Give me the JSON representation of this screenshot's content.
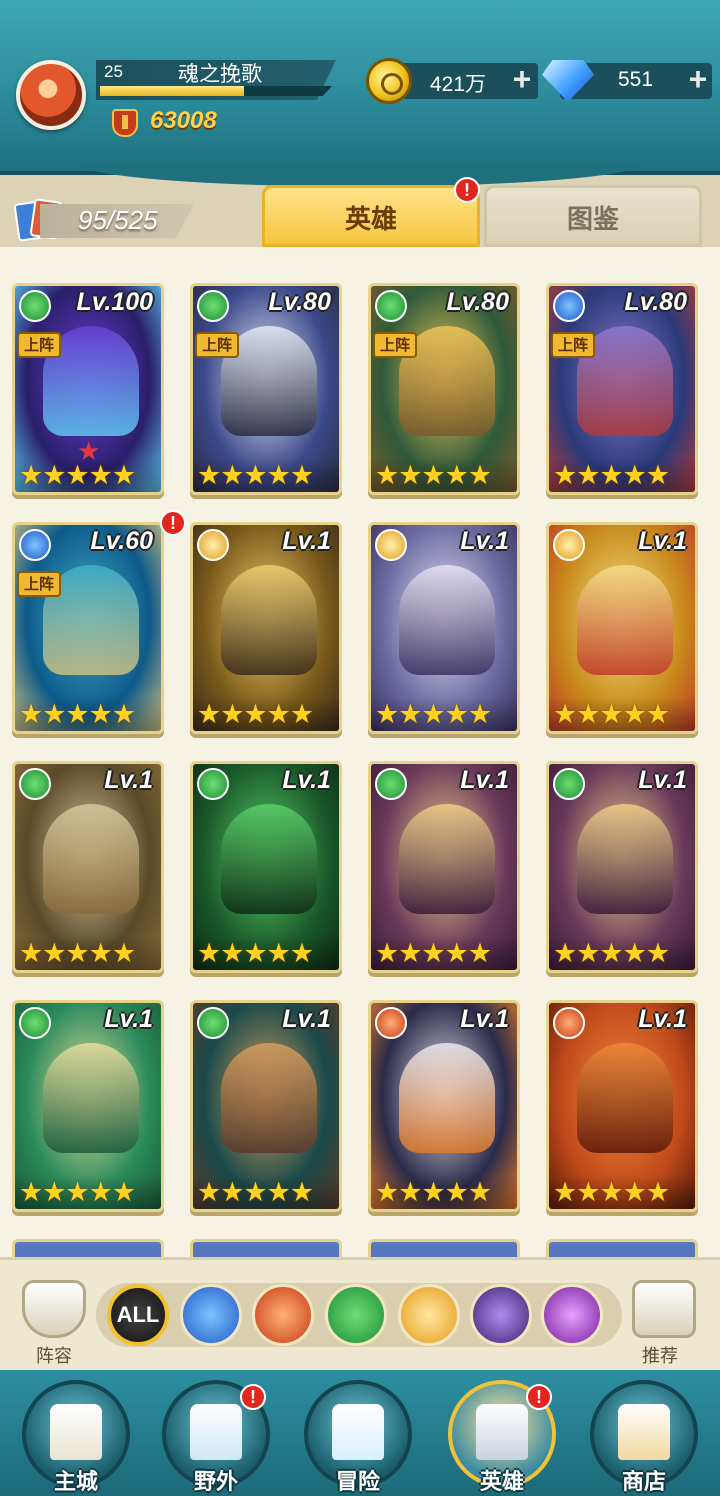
{
  "player": {
    "level": "25",
    "name": "魂之挽歌",
    "xp_fraction": 0.62,
    "power": "63008"
  },
  "resources": {
    "gold": "421万",
    "gems": "551",
    "plus": "+"
  },
  "hero_count": "95/525",
  "tabs": {
    "heroes": "英雄",
    "codex": "图鉴",
    "badge": "!"
  },
  "heroes": [
    {
      "level": "Lv.100",
      "element": "green",
      "deployed": true,
      "stars": "★★★★★",
      "red_star": true,
      "colors": [
        "#2a1f6b",
        "#6a3fd4",
        "#5ec8f0"
      ]
    },
    {
      "level": "Lv.80",
      "element": "green",
      "deployed": true,
      "stars": "★★★★★",
      "colors": [
        "#3b4a8c",
        "#e8ecf5",
        "#2a2a3e"
      ]
    },
    {
      "level": "Lv.80",
      "element": "green",
      "deployed": true,
      "stars": "★★★★★",
      "colors": [
        "#2f5a3a",
        "#f2c75a",
        "#7a5a2a"
      ]
    },
    {
      "level": "Lv.80",
      "element": "blue",
      "deployed": true,
      "stars": "★★★★★",
      "colors": [
        "#2a3a7a",
        "#8c7ad0",
        "#b03a3a"
      ]
    },
    {
      "level": "Lv.60",
      "element": "blue",
      "deployed": true,
      "stars": "★★★★★",
      "badge": true,
      "colors": [
        "#0e5a8a",
        "#3fb0c8",
        "#d0c080"
      ]
    },
    {
      "level": "Lv.1",
      "element": "light",
      "deployed": false,
      "stars": "★★★★★",
      "colors": [
        "#7a5a1a",
        "#f0d070",
        "#3a2a1a"
      ]
    },
    {
      "level": "Lv.1",
      "element": "light",
      "deployed": false,
      "stars": "★★★★★",
      "colors": [
        "#6a6aa0",
        "#e8e4f4",
        "#3a3060"
      ]
    },
    {
      "level": "Lv.1",
      "element": "light",
      "deployed": false,
      "stars": "★★★★★",
      "colors": [
        "#c88a1a",
        "#f5e08a",
        "#c03a2a"
      ]
    },
    {
      "level": "Lv.1",
      "element": "green",
      "deployed": false,
      "stars": "★★★★★",
      "colors": [
        "#5a4a2a",
        "#d8c8a0",
        "#8a6a3a"
      ]
    },
    {
      "level": "Lv.1",
      "element": "green",
      "deployed": false,
      "stars": "★★★★★",
      "colors": [
        "#1a5a2a",
        "#5ad06a",
        "#0e2a14"
      ]
    },
    {
      "level": "Lv.1",
      "element": "green",
      "deployed": false,
      "stars": "★★★★★",
      "colors": [
        "#6a3a5a",
        "#f0d08a",
        "#3a1a3a"
      ]
    },
    {
      "level": "Lv.1",
      "element": "green",
      "deployed": false,
      "stars": "★★★★★",
      "colors": [
        "#6a3a5a",
        "#f0d08a",
        "#3a1a3a"
      ]
    },
    {
      "level": "Lv.1",
      "element": "green",
      "deployed": false,
      "stars": "★★★★★",
      "colors": [
        "#2a8a5a",
        "#e8e0a0",
        "#1a5a3a"
      ]
    },
    {
      "level": "Lv.1",
      "element": "green",
      "deployed": false,
      "stars": "★★★★★",
      "colors": [
        "#1a4a4a",
        "#d8a060",
        "#5a3a2a"
      ]
    },
    {
      "level": "Lv.1",
      "element": "fire",
      "deployed": false,
      "stars": "★★★★★",
      "colors": [
        "#2a2a4a",
        "#e8e8f0",
        "#e07a2a"
      ]
    },
    {
      "level": "Lv.1",
      "element": "fire",
      "deployed": false,
      "stars": "★★★★★",
      "colors": [
        "#c04a1a",
        "#f08a3a",
        "#5a1a0a"
      ]
    }
  ],
  "deploy_label": "上阵",
  "card_badge": "!",
  "filters": {
    "all": "ALL",
    "lineup": "阵容",
    "recommend": "推荐"
  },
  "nav": [
    {
      "label": "主城",
      "icon": "castle-icon",
      "color": "#e9e3d2"
    },
    {
      "label": "野外",
      "icon": "portal-icon",
      "color": "#cfe8f5",
      "badge": true
    },
    {
      "label": "冒险",
      "icon": "sword-icon",
      "color": "#d8f0ff"
    },
    {
      "label": "英雄",
      "icon": "helmet-icon",
      "color": "#c9d3de",
      "badge": true,
      "active": true
    },
    {
      "label": "商店",
      "icon": "shop-icon",
      "color": "#f2d8a0"
    }
  ],
  "nav_badge": "!"
}
